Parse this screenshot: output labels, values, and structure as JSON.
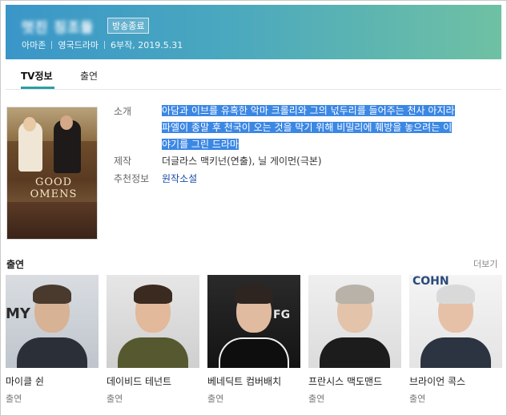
{
  "header": {
    "title": "멋진 징조들",
    "badge": "방송종료",
    "meta": [
      "아마존",
      "영국드라마",
      "6부작, 2019.5.31"
    ]
  },
  "tabs": [
    {
      "label": "TV정보",
      "active": true
    },
    {
      "label": "출연",
      "active": false
    }
  ],
  "info": {
    "intro_label": "소개",
    "intro_lines": [
      "아담과 이브를 유혹한 악마 크롤리와 그의 넋두리를 들어주는 천사 아지라",
      "파엘이 종말 후 천국이 오는 것을 막기 위해 비밀리에 훼방을 놓으려는 이",
      "야기를 그린 드라마"
    ],
    "production_label": "제작",
    "production_value": "더글라스 맥키넌(연출), 닐 게이먼(극본)",
    "recommend_label": "추천정보",
    "recommend_value": "원작소설",
    "poster_text": "GOOD OMENS"
  },
  "cast": {
    "title": "출연",
    "more": "더보기",
    "members": [
      {
        "name": "마이클 쉰",
        "role": "출연",
        "photo_text": "MY F"
      },
      {
        "name": "데이비드 테넌트",
        "role": "출연",
        "photo_text": ""
      },
      {
        "name": "베네딕트 컴버배치",
        "role": "출연",
        "photo_text": "FG"
      },
      {
        "name": "프란시스 맥도맨드",
        "role": "출연",
        "photo_text": ""
      },
      {
        "name": "브라이언 콕스",
        "role": "출연",
        "photo_text": "COHN"
      }
    ]
  },
  "colors": {
    "header_start": "#3a96c8",
    "header_end": "#6fc1a3",
    "tab_accent": "#2c9ea6",
    "selection": "#3b87e4",
    "link": "#1a4aa8"
  }
}
